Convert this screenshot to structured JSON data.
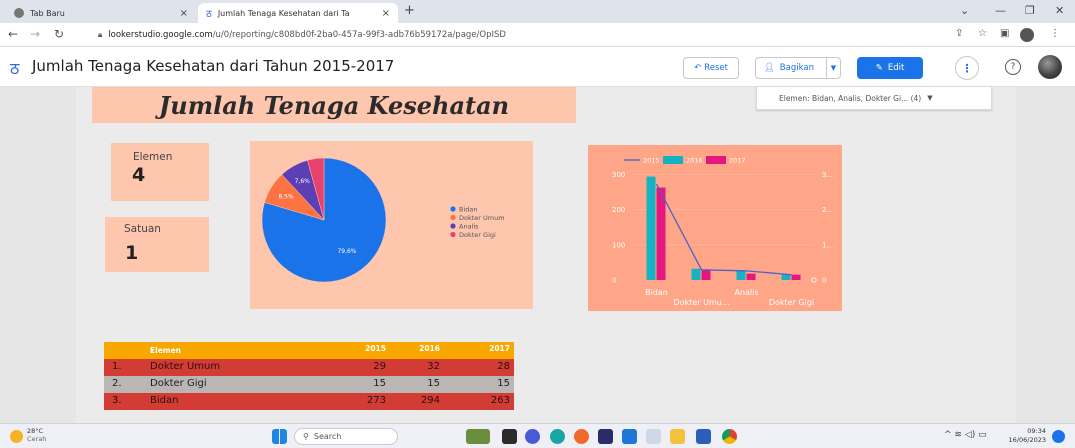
{
  "browser": {
    "tabs": [
      {
        "label": "Tab Baru",
        "active": false
      },
      {
        "label": "Jumlah Tenaga Kesehatan dari Ta",
        "active": true
      }
    ],
    "url_host": "lookerstudio.google.com",
    "url_path": "/u/0/reporting/c808bd0f-2ba0-457a-99f3-adb76b59172a/page/OpISD"
  },
  "header": {
    "title": "Jumlah Tenaga Kesehatan dari Tahun 2015-2017",
    "reset_label": "Reset",
    "share_label": "Bagikan",
    "edit_label": "Edit"
  },
  "report": {
    "hero_title": "Jumlah Tenaga Kesehatan",
    "filter_label": "Elemen: Bidan, Analis, Dokter Gi... (4)",
    "kpi_elemen_label": "Elemen",
    "kpi_elemen_value": "4",
    "kpi_satuan_label": "Satuan",
    "kpi_satuan_value": "1"
  },
  "chart_data": [
    {
      "type": "pie",
      "categories": [
        "Bidan",
        "Dokter Umum",
        "Analis",
        "Dokter Gigi"
      ],
      "values": [
        79.6,
        8.5,
        7.6,
        4.3
      ],
      "labels": [
        "79,6%",
        "8,5%",
        "7,6%",
        ""
      ],
      "colors": [
        "#1a73e8",
        "#fd7242",
        "#5c3fb2",
        "#e8416e"
      ],
      "legend_placement": "right"
    },
    {
      "type": "bar",
      "categories": [
        "Bidan",
        "Dokter Umu...",
        "Analis",
        "Dokter Gigi"
      ],
      "series": [
        {
          "name": "2015",
          "values": [
            273,
            29,
            26,
            15
          ],
          "color": "#4d61c9",
          "mark": "line"
        },
        {
          "name": "2016",
          "values": [
            294,
            32,
            28,
            15
          ],
          "color": "#13b3c1",
          "mark": "bar"
        },
        {
          "name": "2017",
          "values": [
            263,
            28,
            18,
            15
          ],
          "color": "#e3177f",
          "mark": "bar"
        }
      ],
      "yticks": [
        "0",
        "100",
        "200",
        "300"
      ],
      "right_yticks": [
        "0",
        "1...",
        "2...",
        "3..."
      ],
      "ylim": [
        0,
        310
      ],
      "legend_placement": "top-left"
    }
  ],
  "table": {
    "columns": [
      "Elemen",
      "2015",
      "2016",
      "2017"
    ],
    "rows": [
      {
        "no": "1.",
        "name": "Dokter Umum",
        "v2015": "29",
        "v2016": "32",
        "v2017": "28"
      },
      {
        "no": "2.",
        "name": "Dokter Gigi",
        "v2015": "15",
        "v2016": "15",
        "v2017": "15"
      },
      {
        "no": "3.",
        "name": "Bidan",
        "v2015": "273",
        "v2016": "294",
        "v2017": "263"
      }
    ]
  },
  "taskbar": {
    "weather_temp": "28°C",
    "weather_desc": "Cerah",
    "search_placeholder": "Search",
    "time": "09:34",
    "date": "16/06/2023"
  }
}
